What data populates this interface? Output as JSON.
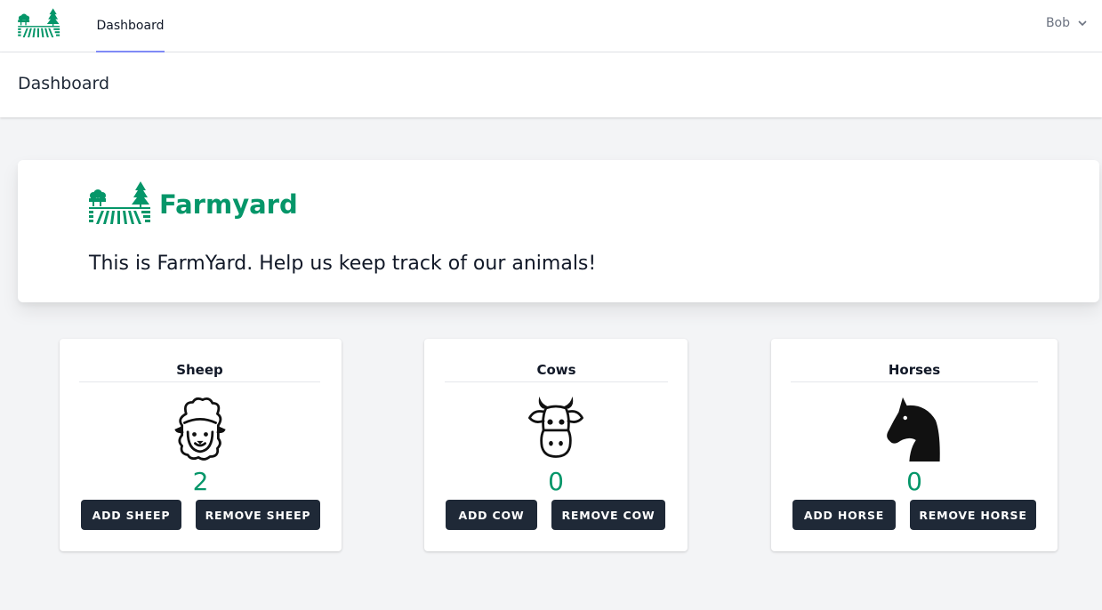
{
  "nav": {
    "tab_label": "Dashboard",
    "user_name": "Bob"
  },
  "header": {
    "title": "Dashboard"
  },
  "welcome": {
    "brand_name": "Farmyard",
    "message": "This is FarmYard. Help us keep track of our animals!"
  },
  "animals": [
    {
      "name": "Sheep",
      "count": "2",
      "add_label": "ADD SHEEP",
      "remove_label": "REMOVE SHEEP"
    },
    {
      "name": "Cows",
      "count": "0",
      "add_label": "ADD COW",
      "remove_label": "REMOVE COW"
    },
    {
      "name": "Horses",
      "count": "0",
      "add_label": "ADD HORSE",
      "remove_label": "REMOVE HORSE"
    }
  ],
  "colors": {
    "brand": "#059669",
    "button_bg": "#1f2937",
    "active_tab": "#818cf8",
    "page_bg": "#f3f4f6"
  },
  "icons": {
    "logo": "farm-field-logo-icon",
    "sheep": "sheep-icon",
    "cow": "cow-icon",
    "horse": "horse-icon",
    "user_menu": "chevron-down-icon"
  }
}
